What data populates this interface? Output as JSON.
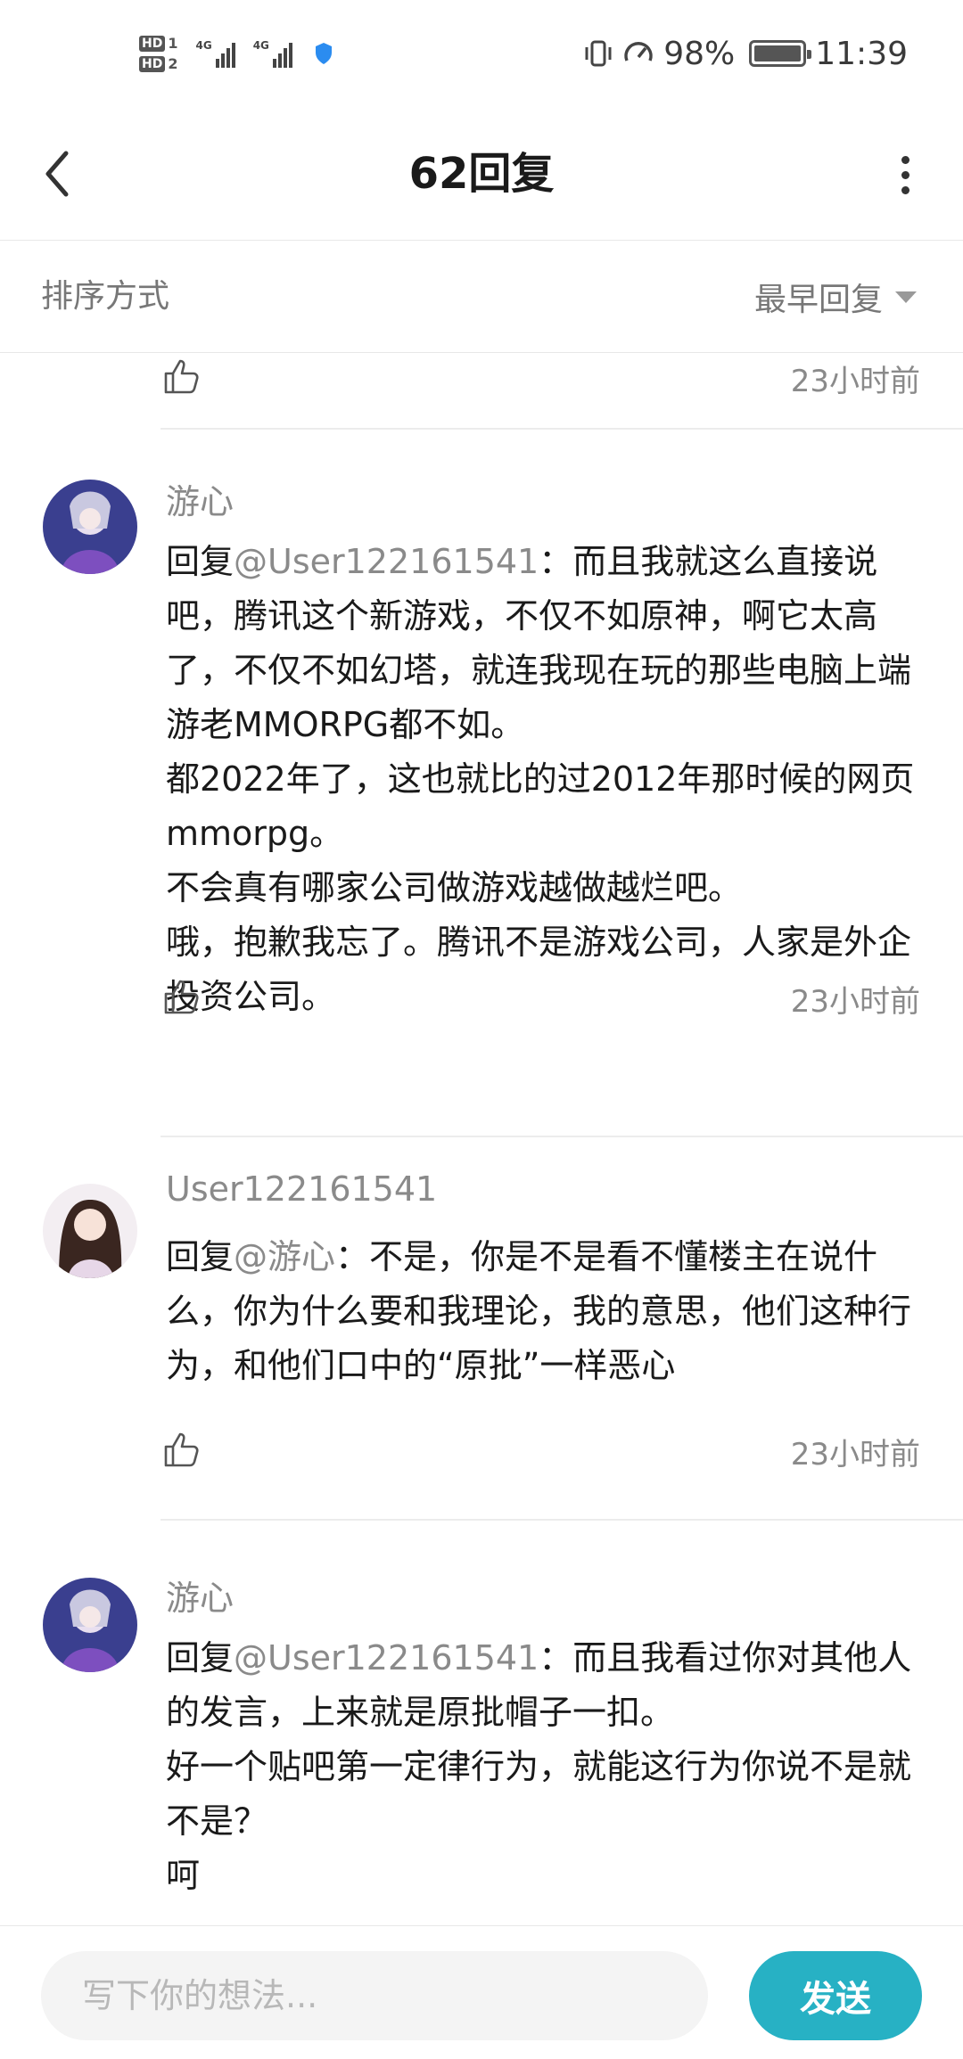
{
  "status_bar": {
    "hd1": "HD",
    "hd1_num": "1",
    "hd2": "HD",
    "hd2_num": "2",
    "net1": "4G",
    "net2": "4G",
    "battery": "98%",
    "time": "11:39"
  },
  "header": {
    "title": "62回复"
  },
  "sort": {
    "label": "排序方式",
    "value": "最早回复"
  },
  "comments": [
    {
      "username": "",
      "mention": "",
      "text": "",
      "time": "23小时前"
    },
    {
      "username": "游心",
      "reply_prefix": "回复",
      "mention": "@User122161541",
      "text": "：而且我就这么直接说吧，腾讯这个新游戏，不仅不如原神，啊它太高了，不仅不如幻塔，就连我现在玩的那些电脑上端游老MMORPG都不如。\n都2022年了，这也就比的过2012年那时候的网页mmorpg。\n不会真有哪家公司做游戏越做越烂吧。\n哦，抱歉我忘了。腾讯不是游戏公司，人家是外企投资公司。",
      "time": "23小时前"
    },
    {
      "username": "User122161541",
      "reply_prefix": "回复",
      "mention": "@游心",
      "text": "：不是，你是不是看不懂楼主在说什么，你为什么要和我理论，我的意思，他们这种行为，和他们口中的“原批”一样恶心",
      "time": "23小时前"
    },
    {
      "username": "游心",
      "reply_prefix": "回复",
      "mention": "@User122161541",
      "text": "：而且我看过你对其他人的发言，上来就是原批帽子一扣。\n好一个贴吧第一定律行为，就能这行为你说不是就不是？\n呵",
      "time": ""
    }
  ],
  "bottom": {
    "placeholder": "写下你的想法...",
    "send_label": "发送"
  },
  "colors": {
    "accent": "#27b1c4",
    "muted": "#8a8a8a"
  }
}
